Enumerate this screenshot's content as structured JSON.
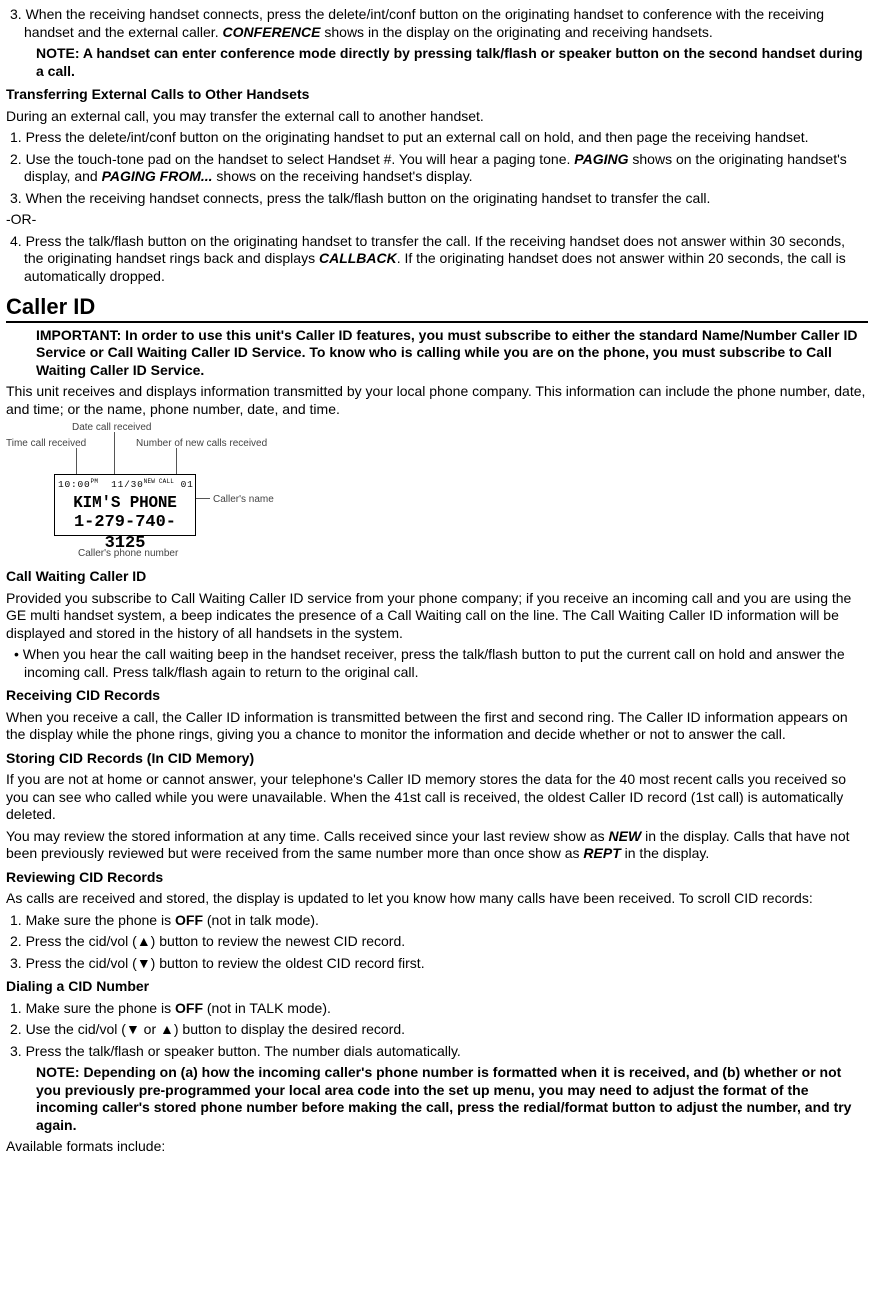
{
  "s1": {
    "item3a": "3. When the receiving handset connects, press the delete/int/conf button on the originating handset to conference with the receiving handset and the external caller. ",
    "item3b": " shows in the display on the originating and receiving handsets.",
    "conf": "CONFERENCE",
    "note": "NOTE: A handset can enter conference mode directly by pressing talk/flash or speaker button on the second handset during a call."
  },
  "transfer": {
    "hdr": "Transferring External Calls to Other Handsets",
    "intro": "During an external call, you may transfer the external call to another handset.",
    "i1": "1. Press the delete/int/conf button on the originating handset to put an external call on hold, and then page the receiving handset.",
    "i2a": "2. Use the touch-tone pad on the handset to select Handset #. You will hear a paging tone. ",
    "paging": "PAGING",
    "i2b": " shows on the originating handset's display, and ",
    "pagingfrom": "PAGING FROM...",
    "i2c": " shows on the receiving handset's display.",
    "i3": "3. When the receiving handset connects, press the talk/flash button on the originating handset to transfer the call.",
    "or": "-OR-",
    "i4a": "4. Press the talk/flash button on the originating handset to transfer the call. If the receiving handset does not answer within 30 seconds, the originating handset rings back and displays ",
    "callback": "CALLBACK",
    "i4b": ". If the originating handset does not answer within 20 seconds, the call is automatically dropped."
  },
  "cid": {
    "title": "Caller ID",
    "important": "IMPORTANT: In order to use this unit's Caller ID features, you must subscribe to either the standard Name/Number Caller ID Service or Call Waiting Caller ID Service. To know who is calling while you are on the phone, you must subscribe to Call Waiting Caller ID Service.",
    "intro": "This unit receives and displays information transmitted by your local phone company. This information can include the phone number, date, and time; or the name, phone number, date, and time."
  },
  "fig": {
    "date": "Date call received",
    "time": "Time call received",
    "newcalls": "Number of new calls received",
    "cname": "Caller's name",
    "cphone": "Caller's phone number",
    "lcd_row1_time": "10:00",
    "lcd_row1_pm": "PM",
    "lcd_row1_date": "11/30",
    "lcd_row1_new": "NEW CALL",
    "lcd_row1_cnt": "01",
    "lcd_row2": "KIM'S PHONE",
    "lcd_row3": "1-279-740-3125"
  },
  "cw": {
    "hdr": "Call Waiting Caller ID",
    "p": "Provided you subscribe to Call Waiting Caller ID service from your phone company; if you receive an incoming call and you are using the GE multi handset system, a beep indicates the presence of a Call Waiting call on the line. The Call Waiting Caller ID information will be displayed and stored in the history of all handsets in the system.",
    "b": "• When you hear the call waiting beep in the handset receiver, press the talk/flash button to put the current call on hold and answer the incoming call. Press talk/flash again to return to the original call."
  },
  "rx": {
    "hdr": "Receiving CID Records",
    "p": "When you receive a call, the Caller ID information is transmitted between the first and second ring. The Caller ID information appears on the display while the phone rings, giving you a chance to monitor the information and decide whether or not to answer the call."
  },
  "store": {
    "hdr": "Storing CID Records (In CID Memory)",
    "p1": "If you are not at home or cannot answer, your telephone's Caller ID memory stores the data for the 40 most recent calls you received so you can see who called while you were unavailable. When the 41st call is received, the oldest Caller ID record (1st call) is automatically deleted.",
    "p2a": "You may review the stored information at any time. Calls received since your last review show as ",
    "new": "NEW",
    "p2b": " in the display. Calls that have not been previously reviewed but were received from the same number more than once show as ",
    "rept": "REPT",
    "p2c": " in the display."
  },
  "rev": {
    "hdr": "Reviewing CID Records",
    "p": "As calls are received and stored, the display is updated to let you know how many calls have been received. To scroll CID records:",
    "i1a": "1. Make sure the phone is ",
    "off": "OFF",
    "i1b": " (not in talk mode).",
    "i2a": "2. Press the ",
    "cidup": "cid/vol (▲)",
    "i2b": " button to review the newest CID record.",
    "i3a": "3. Press the ",
    "ciddn": "cid/vol (▼)",
    "i3b": " button to review the oldest CID record first."
  },
  "dial": {
    "hdr": "Dialing a CID Number",
    "i1a": "1. Make sure the phone is ",
    "off": "OFF",
    "i1b": " (not in TALK mode).",
    "i2a": "2. Use the ",
    "cidbtn": "cid/vol (▼ or ▲)",
    "i2b": " button to display the desired record.",
    "i3": "3. Press the talk/flash or speaker button. The number dials automatically.",
    "note": "NOTE: Depending on (a) how the incoming caller's phone number is formatted when it is received, and (b) whether or not you previously pre-programmed your local area code into the set up menu, you may need to adjust the format of the incoming caller's stored phone number before making the call, press the redial/format button to adjust the number, and try again.",
    "avail": "Available formats include:"
  }
}
